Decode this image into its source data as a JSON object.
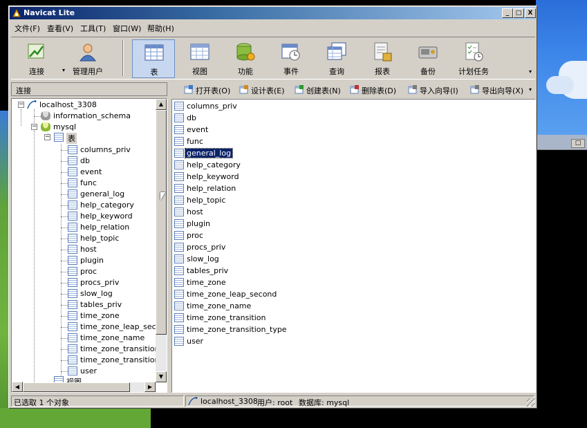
{
  "window": {
    "title": "Navicat Lite",
    "controls": {
      "minimize": "_",
      "maximize": "□",
      "close": "X"
    }
  },
  "menubar": [
    {
      "label": "文件(F)"
    },
    {
      "label": "查看(V)"
    },
    {
      "label": "工具(T)"
    },
    {
      "label": "窗口(W)"
    },
    {
      "label": "帮助(H)"
    }
  ],
  "toolbar": [
    {
      "label": "连接",
      "icon": "connect-icon"
    },
    {
      "label": "管理用户",
      "icon": "user-icon"
    },
    {
      "label": "表",
      "icon": "table-icon"
    },
    {
      "label": "视图",
      "icon": "view-icon"
    },
    {
      "label": "功能",
      "icon": "function-icon"
    },
    {
      "label": "事件",
      "icon": "event-icon"
    },
    {
      "label": "查询",
      "icon": "query-icon"
    },
    {
      "label": "报表",
      "icon": "report-icon"
    },
    {
      "label": "备份",
      "icon": "backup-icon"
    },
    {
      "label": "计划任务",
      "icon": "schedule-icon"
    }
  ],
  "left_panel": {
    "header": "连接",
    "tree": {
      "connection": "localhost_3308",
      "databases": [
        "information_schema",
        "mysql"
      ],
      "table_folder": "表",
      "tables": [
        "columns_priv",
        "db",
        "event",
        "func",
        "general_log",
        "help_category",
        "help_keyword",
        "help_relation",
        "help_topic",
        "host",
        "plugin",
        "proc",
        "procs_priv",
        "slow_log",
        "tables_priv",
        "time_zone",
        "time_zone_leap_secor",
        "time_zone_name",
        "time_zone_transition",
        "time_zone_transition_",
        "user"
      ],
      "view_folder": "视图"
    }
  },
  "object_toolbar": [
    {
      "label": "打开表(O)",
      "icon": "open-table-icon"
    },
    {
      "label": "设计表(E)",
      "icon": "design-table-icon"
    },
    {
      "label": "创建表(N)",
      "icon": "create-table-icon"
    },
    {
      "label": "删除表(D)",
      "icon": "delete-table-icon"
    },
    {
      "label": "导入向导(I)",
      "icon": "import-wizard-icon"
    },
    {
      "label": "导出向导(X)",
      "icon": "export-wizard-icon"
    }
  ],
  "object_list": {
    "selected": "general_log",
    "items": [
      "columns_priv",
      "db",
      "event",
      "func",
      "general_log",
      "help_category",
      "help_keyword",
      "help_relation",
      "help_topic",
      "host",
      "plugin",
      "proc",
      "procs_priv",
      "slow_log",
      "tables_priv",
      "time_zone",
      "time_zone_leap_second",
      "time_zone_name",
      "time_zone_transition",
      "time_zone_transition_type",
      "user"
    ]
  },
  "statusbar": {
    "selection": "已选取 1 个对象",
    "connection": "localhost_3308",
    "user": "用户: root",
    "database": "数据库: mysql"
  },
  "colors": {
    "title_gradient_start": "#0a246a",
    "title_gradient_end": "#a6caf0",
    "selection": "#0a246a",
    "face": "#d4d0c8"
  }
}
